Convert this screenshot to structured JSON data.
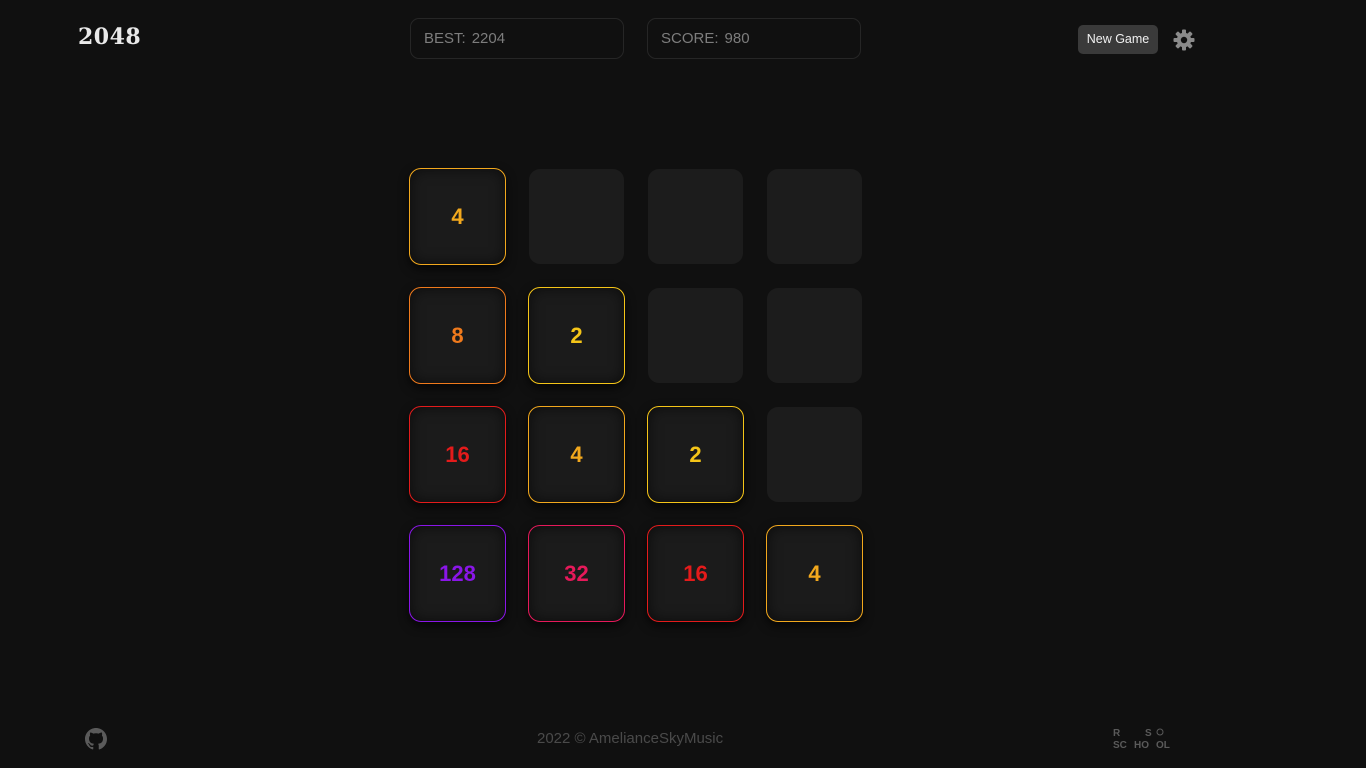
{
  "header": {
    "logo": "2048",
    "best_label": "BEST:",
    "best_value": "2204",
    "score_label": "SCORE:",
    "score_value": "980",
    "new_game_label": "New Game",
    "settings_icon": "gear-icon"
  },
  "board": {
    "size": 4,
    "grid": [
      [
        4,
        0,
        0,
        0
      ],
      [
        8,
        2,
        0,
        0
      ],
      [
        16,
        4,
        2,
        0
      ],
      [
        128,
        32,
        16,
        4
      ]
    ],
    "tile_colors": {
      "2": "#f5c518",
      "4": "#f2a81d",
      "8": "#f07a1c",
      "16": "#e41b1b",
      "32": "#e6195a",
      "128": "#8a16e8"
    }
  },
  "footer": {
    "github_icon": "github-icon",
    "copyright": "2022 © AmelianceSkyMusic",
    "school_logo": "rs-school-logo",
    "school_logo_text": [
      "R",
      "S",
      "SC",
      "HO",
      "OL"
    ]
  }
}
